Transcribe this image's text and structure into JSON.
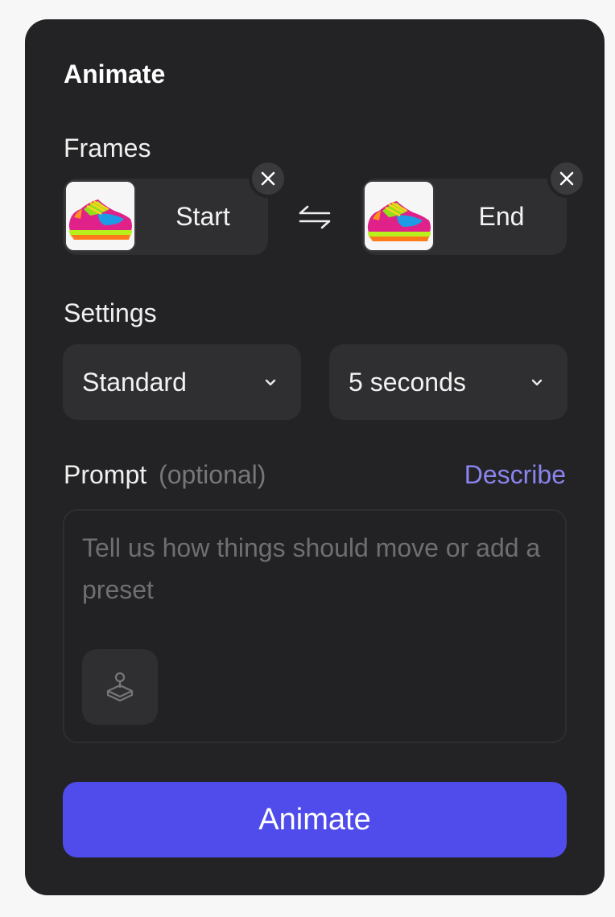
{
  "panel": {
    "title": "Animate"
  },
  "frames": {
    "label": "Frames",
    "start": {
      "label": "Start"
    },
    "end": {
      "label": "End"
    }
  },
  "settings": {
    "label": "Settings",
    "quality": {
      "selected": "Standard"
    },
    "duration": {
      "selected": "5 seconds"
    }
  },
  "prompt": {
    "label": "Prompt",
    "optional_hint": "(optional)",
    "describe_link": "Describe",
    "placeholder": "Tell us how things should move or add a preset",
    "value": ""
  },
  "actions": {
    "animate_label": "Animate"
  },
  "colors": {
    "panel_bg": "#232325",
    "card_bg": "#2f2f32",
    "accent": "#4f4ceb",
    "link": "#8a84ee"
  },
  "icons": {
    "remove": "close-icon",
    "swap": "swap-arrows-icon",
    "dropdown": "chevron-down-icon",
    "preset": "joystick-icon"
  }
}
